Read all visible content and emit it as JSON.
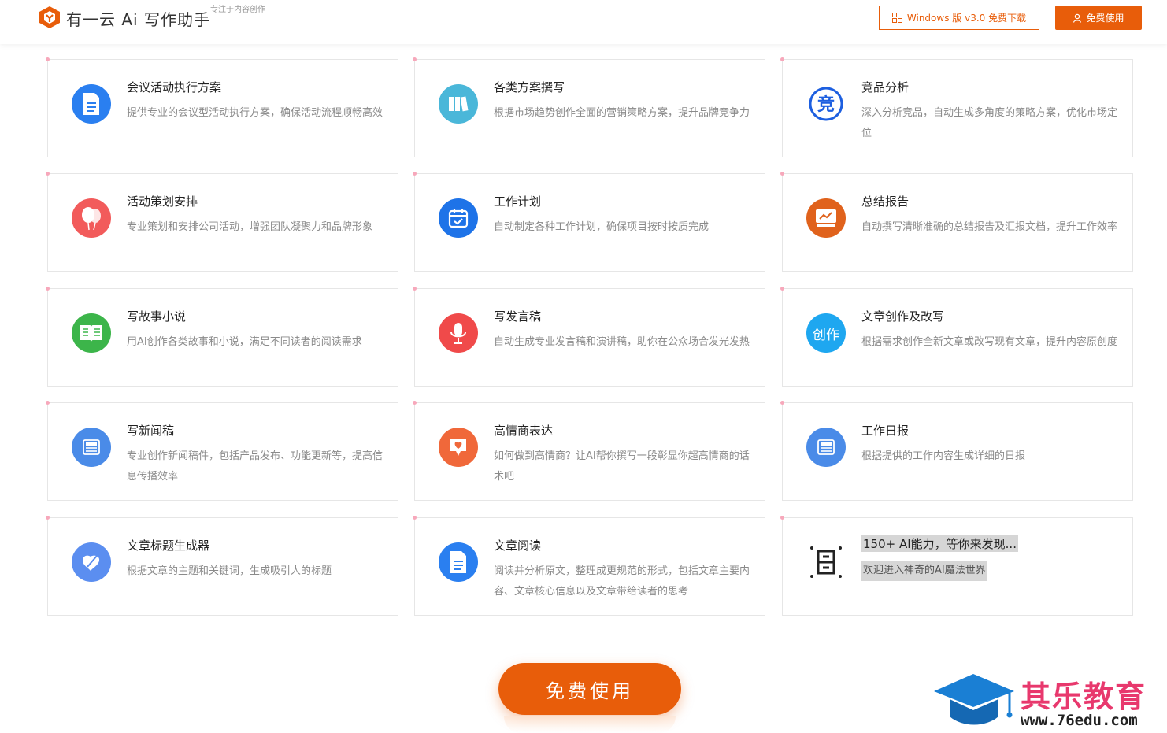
{
  "header": {
    "logo_text": "有一云 Ai 写作助手",
    "slogan": "专注于内容创作",
    "download_label": "Windows 版 v3.0 免费下载",
    "free_label": "免费使用"
  },
  "colors": {
    "brand": "#e85d0a",
    "card_border": "#e6e6e6",
    "corner_dot": "#f7a8bb"
  },
  "cards": [
    {
      "title": "会议活动执行方案",
      "desc": "提供专业的会议型活动执行方案，确保活动流程顺畅高效",
      "icon": "document-icon",
      "icon_color": "#2a7ff0"
    },
    {
      "title": "各类方案撰写",
      "desc": "根据市场趋势创作全面的营销策略方案，提升品牌竞争力",
      "icon": "books-icon",
      "icon_color": "#4ab7d9"
    },
    {
      "title": "竞品分析",
      "desc": "深入分析竞品，自动生成多角度的策略方案，优化市场定位",
      "icon": "compete-icon",
      "icon_color": "#1d5fe0"
    },
    {
      "title": "活动策划安排",
      "desc": "专业策划和安排公司活动，增强团队凝聚力和品牌形象",
      "icon": "balloon-icon",
      "icon_color": "#f25b5b"
    },
    {
      "title": "工作计划",
      "desc": "自动制定各种工作计划，确保项目按时按质完成",
      "icon": "calendar-icon",
      "icon_color": "#1e73e8"
    },
    {
      "title": "总结报告",
      "desc": "自动撰写清晰准确的总结报告及汇报文档，提升工作效率",
      "icon": "report-icon",
      "icon_color": "#e0621c"
    },
    {
      "title": "写故事小说",
      "desc": "用AI创作各类故事和小说，满足不同读者的阅读需求",
      "icon": "open-book-icon",
      "icon_color": "#3cb54a"
    },
    {
      "title": "写发言稿",
      "desc": "自动生成专业发言稿和演讲稿，助你在公众场合发光发热",
      "icon": "microphone-icon",
      "icon_color": "#f04a4a"
    },
    {
      "title": "文章创作及改写",
      "desc": "根据需求创作全新文章或改写现有文章，提升内容原创度",
      "icon": "create-icon",
      "icon_color": "#1ea7f0",
      "icon_text": "创作"
    },
    {
      "title": "写新闻稿",
      "desc": "专业创作新闻稿件，包括产品发布、功能更新等，提高信息传播效率",
      "icon": "news-icon",
      "icon_color": "#4a8be8"
    },
    {
      "title": "高情商表达",
      "desc": "如何做到高情商？让AI帮你撰写一段彰显你超高情商的话术吧",
      "icon": "heart-chat-icon",
      "icon_color": "#f0683a"
    },
    {
      "title": "工作日报",
      "desc": "根据提供的工作内容生成详细的日报",
      "icon": "daily-report-icon",
      "icon_color": "#4a8be8"
    },
    {
      "title": "文章标题生成器",
      "desc": "根据文章的主题和关键词，生成吸引人的标题",
      "icon": "title-pen-icon",
      "icon_color": "#5b8ef0"
    },
    {
      "title": "文章阅读",
      "desc": "阅读并分析原文，整理成更规范的形式，包括文章主要内容、文章核心信息以及文章带给读者的思考",
      "icon": "article-icon",
      "icon_color": "#2a7ff0"
    },
    {
      "title": "150+ AI能力，等你来发现...",
      "desc": "欢迎进入神奇的AI魔法世界",
      "icon": "scan-icon",
      "icon_color": "#222222"
    }
  ],
  "cta": {
    "label": "免费使用"
  },
  "watermark": {
    "title": "其乐教育",
    "url": "www.76edu.com"
  }
}
